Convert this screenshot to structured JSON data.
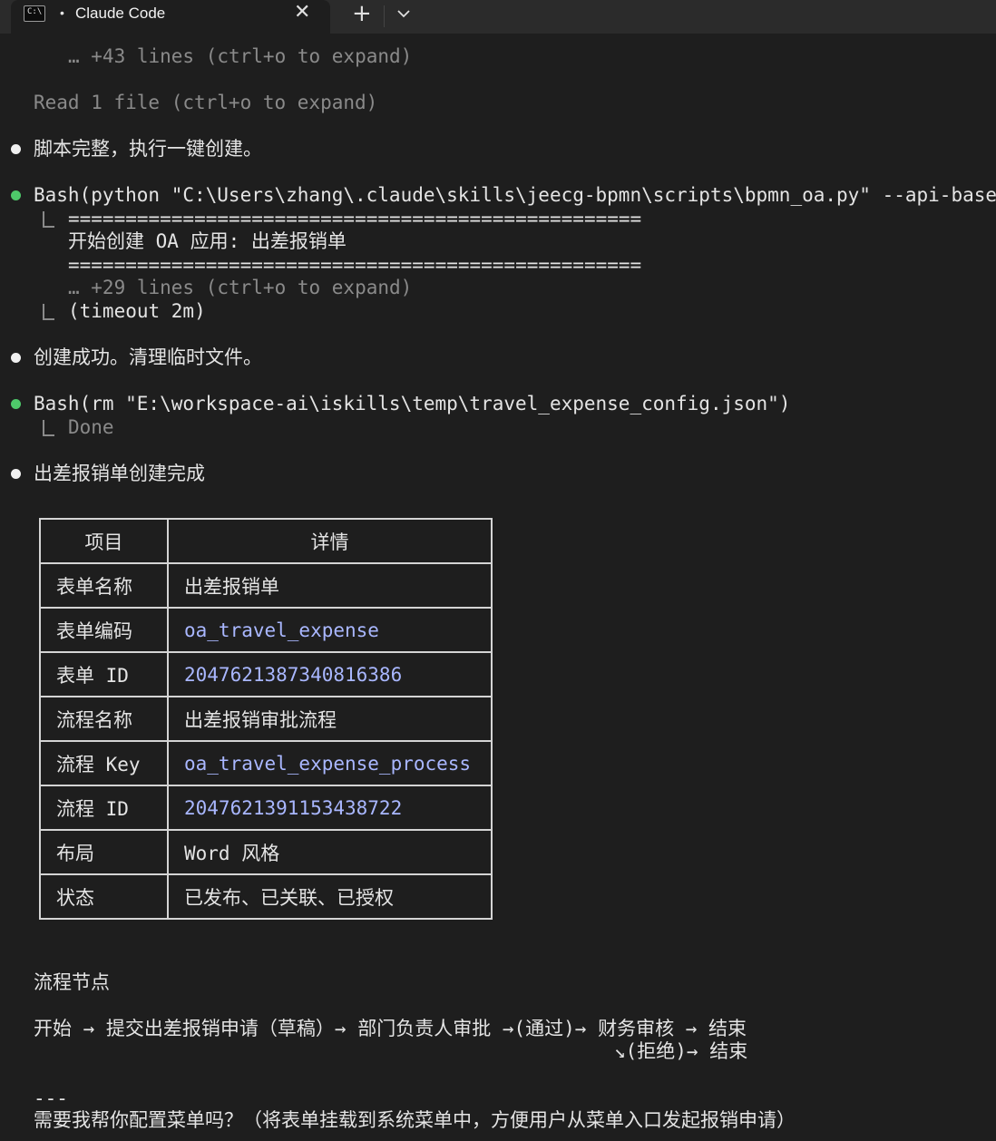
{
  "window": {
    "tab_title": "Claude Code",
    "tab_dot": "•",
    "close_glyph": "✕",
    "new_tab_glyph": "+",
    "terminal_icon_text": "C:\\"
  },
  "transcript": {
    "collapsed_1": "… +43 lines (ctrl+o to expand)",
    "read_files": "Read 1 file (ctrl+o to expand)",
    "msg_script_ok": "脚本完整，执行一键创建。",
    "bash1_cmd": "Bash(python \"C:\\Users\\zhang\\.claude\\skills\\jeecg-bpmn\\scripts\\bpmn_oa.py\" --api-base",
    "bash1_rule1": "==================================================",
    "bash1_heading": "开始创建 OA 应用: 出差报销单",
    "bash1_rule2": "==================================================",
    "bash1_collapsed": "… +29 lines (ctrl+o to expand)",
    "bash1_timeout": "(timeout 2m)",
    "msg_created": "创建成功。清理临时文件。",
    "bash2_cmd": "Bash(rm \"E:\\workspace-ai\\iskills\\temp\\travel_expense_config.json\")",
    "bash2_result": "Done",
    "msg_complete": "出差报销单创建完成"
  },
  "table": {
    "headers": [
      "项目",
      "详情"
    ],
    "rows": [
      [
        "表单名称",
        "出差报销单"
      ],
      [
        "表单编码",
        "oa_travel_expense"
      ],
      [
        "表单 ID",
        "2047621387340816386"
      ],
      [
        "流程名称",
        "出差报销审批流程"
      ],
      [
        "流程 Key",
        "oa_travel_expense_process"
      ],
      [
        "流程 ID",
        "2047621391153438722"
      ],
      [
        "布局",
        "Word 风格"
      ],
      [
        "状态",
        "已发布、已关联、已授权"
      ]
    ]
  },
  "flow": {
    "title": "流程节点",
    "line1": "开始 → 提交出差报销申请（草稿）→ 部门负责人审批 →(通过)→ 财务审核 → 结束",
    "line2": "↘(拒绝)→ 结束"
  },
  "footer": {
    "rule": "---",
    "question": "需要我帮你配置菜单吗？（将表单挂载到系统菜单中，方便用户从菜单入口发起报销申请）"
  },
  "colors": {
    "background": "#1e1e1e",
    "success_bullet": "#4ec96a",
    "code_text": "#a9b7ff"
  }
}
